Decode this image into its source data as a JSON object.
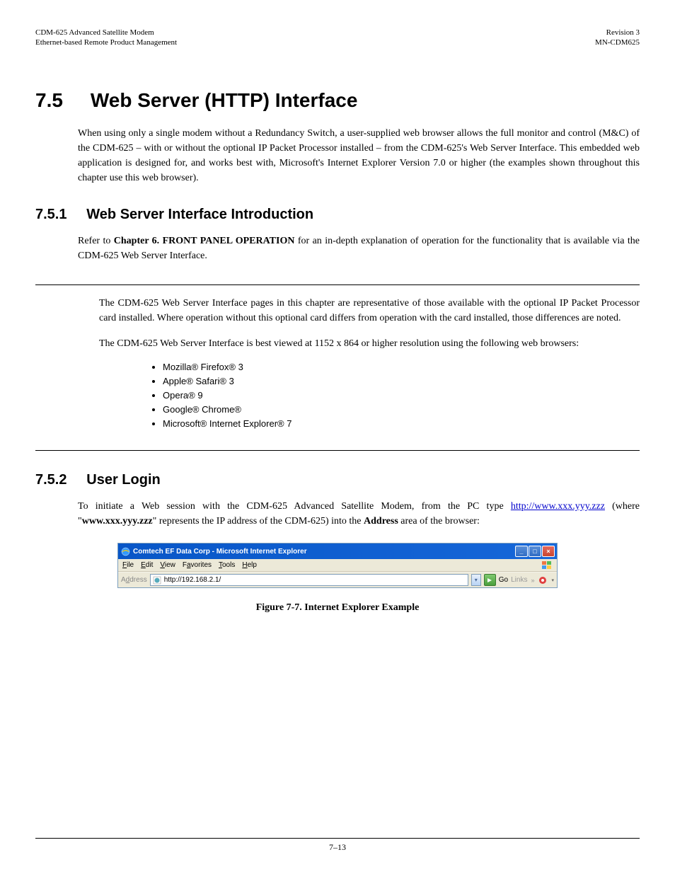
{
  "header": {
    "left_line1": "CDM-625 Advanced Satellite Modem",
    "left_line2": "Ethernet-based Remote Product Management",
    "right_line1": "Revision 3",
    "right_line2": "MN-CDM625"
  },
  "section": {
    "number1": "7.5",
    "title1": "Web Server (HTTP) Interface",
    "p1": "When using only a single modem without a Redundancy Switch, a user-supplied web browser allows the full monitor and control (M&C) of the CDM-625 – with or without the optional IP Packet Processor installed – from the CDM-625's Web Server Interface. This embedded web application is designed for, and works best with, Microsoft's Internet Explorer Version 7.0 or higher (the examples shown throughout this chapter use this web browser).",
    "number2": "7.5.1",
    "title2": "Web Server Interface Introduction",
    "p2_prefix": "Refer to ",
    "p2_bold": "Chapter 6. FRONT PANEL OPERATION",
    "p2_suffix": " for an in-depth explanation of operation for the functionality that is available via the CDM-625 Web Server Interface.",
    "p3": "The CDM-625 Web Server Interface pages in this chapter are representative of those available with the optional IP Packet Processor card installed. Where operation without this optional card differs from operation with the card installed, those differences are noted.",
    "p4": "The CDM-625 Web Server Interface is best viewed at 1152 x 864 or higher resolution using the following web browsers:",
    "browsers": [
      "Mozilla® Firefox® 3",
      "Apple® Safari® 3",
      "Opera® 9",
      "Google® Chrome®",
      "Microsoft® Internet Explorer® 7"
    ],
    "number3": "7.5.2",
    "title3": "User Login",
    "p5": "To initiate a Web session with the CDM-625 Advanced Satellite Modem, from the PC type ",
    "p5_url": "http://www.xxx.yyy.zzz",
    "p5_suffix": " (where \"",
    "p5_bold": "www.xxx.yyy.zzz",
    "p5_suffix2": "\" represents the IP address of the CDM-625) into the ",
    "p5_bold2": "Address",
    "p5_suffix3": " area of the browser:"
  },
  "browserImg": {
    "title": "Comtech EF Data Corp - Microsoft Internet Explorer",
    "menu": {
      "file": "File",
      "edit": "Edit",
      "view": "View",
      "favorites": "Favorites",
      "tools": "Tools",
      "help": "Help"
    },
    "addressLabel": "Address",
    "url": "http://192.168.2.1/",
    "go": "Go",
    "links": "Links"
  },
  "figure": {
    "caption": "Figure 7-7. Internet Explorer Example"
  },
  "footer": {
    "page": "7–13"
  }
}
